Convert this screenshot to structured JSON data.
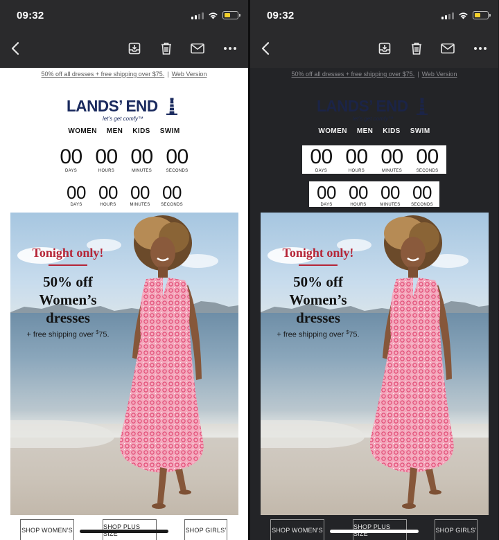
{
  "status": {
    "time": "09:32",
    "signal_icon": "cellular-signal-icon",
    "wifi_icon": "wifi-icon",
    "battery_icon": "battery-low-icon",
    "battery_color": "#f3d02b"
  },
  "toolbar": {
    "icons": [
      "back-chevron-icon",
      "archive-icon",
      "trash-icon",
      "mail-icon",
      "more-icon"
    ]
  },
  "email": {
    "preheader_link": "50% off all dresses + free shipping over $75.",
    "preheader_separator": "|",
    "web_version": "Web Version",
    "logo_text": "LANDS’ END",
    "logo_tagline": "let’s get comfy™",
    "nav": [
      "WOMEN",
      "MEN",
      "KIDS",
      "SWIM"
    ],
    "countdown": [
      {
        "value": "00",
        "label": "DAYS"
      },
      {
        "value": "00",
        "label": "HOURS"
      },
      {
        "value": "00",
        "label": "MINUTES"
      },
      {
        "value": "00",
        "label": "SECONDS"
      }
    ],
    "promo": {
      "tonight": "Tonight only!",
      "headline_line1": "50% off",
      "headline_line2": "Women’s",
      "headline_line3": "dresses",
      "sub_prefix": "+ free shipping over ",
      "sub_currency": "$",
      "sub_amount": "75."
    },
    "shop_buttons": [
      "SHOP WOMEN’S",
      "SHOP PLUS SIZE",
      "SHOP GIRLS’"
    ]
  },
  "colors": {
    "brand_navy": "#1a2a5e",
    "promo_red": "#b52436",
    "light_bg": "#ffffff",
    "dark_bg": "#232427",
    "toolbar_bg": "#2a2a2c"
  }
}
